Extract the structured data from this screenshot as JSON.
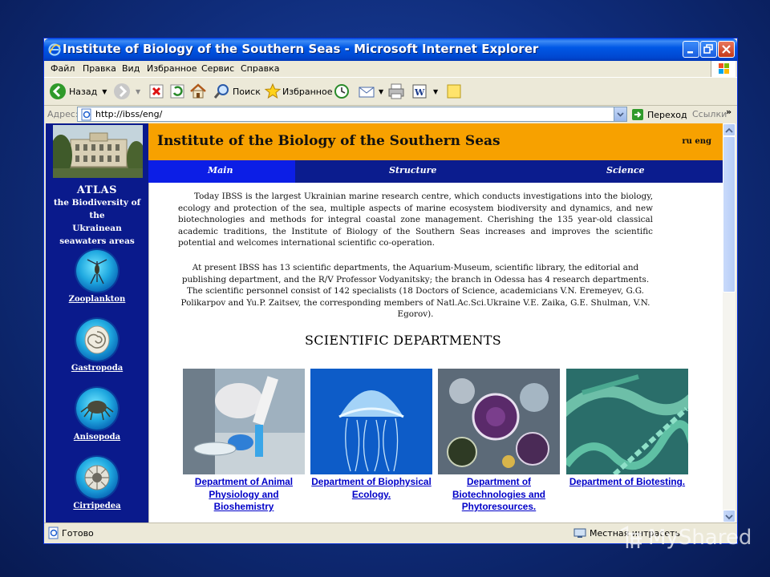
{
  "window": {
    "title": "Institute of Biology of the Southern Seas - Microsoft Internet Explorer"
  },
  "menu": [
    "Файл",
    "Правка",
    "Вид",
    "Избранное",
    "Сервис",
    "Справка"
  ],
  "toolbar": {
    "back": "Назад",
    "search": "Поиск",
    "favorites": "Избранное"
  },
  "address": {
    "label": "Адрес:",
    "url": "http://ibss/eng/",
    "go": "Переход",
    "links": "Ссылки"
  },
  "status": {
    "left": "Готово",
    "zone": "Местная интрасеть"
  },
  "site": {
    "title": "Institute of the Biology of the Southern Seas",
    "lang": "ru eng",
    "nav": [
      "Main",
      "Structure",
      "Science"
    ]
  },
  "sidebar": {
    "atlas_title": "ATLAS",
    "atlas_lines": [
      "the Biodiversity of the",
      "Ukrainean",
      "seawaters areas"
    ],
    "links": [
      "Zooplankton",
      "Gastropoda",
      "Anisopoda",
      "Cirripedea"
    ]
  },
  "content": {
    "para1": "Today IBSS is the largest Ukrainian marine research centre, which conducts investigations into the biology, ecology and protection of the sea, multiple aspects of marine ecosystem biodiversity and dynamics, and new biotechnologies and methods for integral coastal zone management. Cherishing the 135 year-old classical academic traditions, the Institute of Biology of the Southern Seas increases and improves the scientific potential and welcomes international scientific co-operation.",
    "para2": "At present IBSS has 13 scientific departments, the Aquarium-Museum, scientific library, the editorial and publishing department, and the R/V Professor Vodyanitsky; the branch in Odessa has 4 research departments. The scientific personnel consist of 142 specialists (18 Doctors of Science, academicians V.N. Eremeyev, G.G. Polikarpov and Yu.P. Zaitsev, the corresponding members of Natl.Ac.Sci.Ukraine V.E. Zaika, G.E. Shulman, V.N. Egorov).",
    "departments_title": "SCIENTIFIC DEPARTMENTS",
    "departments": [
      "Department of Animal Physiology and Bioshemistry",
      "Department of Biophysical Ecology.",
      "Department of Biotechnologies and Phytoresources.",
      "Department of Biotesting."
    ]
  },
  "watermark": "MyShared"
}
